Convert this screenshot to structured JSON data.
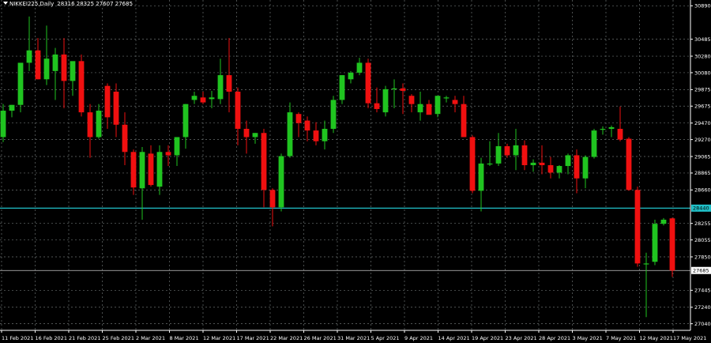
{
  "header": {
    "symbol": "NIKKEI225,Daily",
    "ohlc": "28316 28325 27607 27685"
  },
  "colors": {
    "bull": "#20c420",
    "bear": "#f01010",
    "grid": "#6a7070",
    "hline": "#20c0c8",
    "background": "#000000"
  },
  "chart_data": {
    "type": "candlestick",
    "symbol": "NIKKEI225",
    "timeframe": "Daily",
    "ylim": [
      26960,
      30960
    ],
    "y_ticks": [
      30890,
      30485,
      30280,
      30080,
      29875,
      29675,
      29470,
      29270,
      29065,
      28865,
      28660,
      28255,
      28055,
      27850,
      27445,
      27240,
      27040
    ],
    "x_labels": [
      "11 Feb 2021",
      "16 Feb 2021",
      "21 Feb 2021",
      "25 Feb 2021",
      "2 Mar 2021",
      "8 Mar 2021",
      "12 Mar 2021",
      "17 Mar 2021",
      "22 Mar 2021",
      "26 Mar 2021",
      "31 Mar 2021",
      "5 Apr 2021",
      "9 Apr 2021",
      "14 Apr 2021",
      "19 Apr 2021",
      "23 Apr 2021",
      "28 Apr 2021",
      "3 May 2021",
      "7 May 2021",
      "12 May 2021",
      "17 May 2021"
    ],
    "hlines": [
      {
        "value": 28440,
        "label": "28440"
      },
      {
        "value": 27685,
        "label": "27685"
      }
    ],
    "candles": [
      {
        "o": 29300,
        "h": 29700,
        "l": 29240,
        "c": 29620
      },
      {
        "o": 29620,
        "h": 29690,
        "l": 29540,
        "c": 29690
      },
      {
        "o": 29690,
        "h": 30050,
        "l": 29600,
        "c": 30200
      },
      {
        "o": 30200,
        "h": 30760,
        "l": 30100,
        "c": 30350
      },
      {
        "o": 30350,
        "h": 30500,
        "l": 30000,
        "c": 30000
      },
      {
        "o": 30000,
        "h": 30650,
        "l": 29930,
        "c": 30250
      },
      {
        "o": 30100,
        "h": 30380,
        "l": 29750,
        "c": 30300
      },
      {
        "o": 30300,
        "h": 30500,
        "l": 29650,
        "c": 29980
      },
      {
        "o": 29980,
        "h": 30150,
        "l": 29800,
        "c": 30220
      },
      {
        "o": 30220,
        "h": 30300,
        "l": 29550,
        "c": 29600
      },
      {
        "o": 29600,
        "h": 29700,
        "l": 29050,
        "c": 29300
      },
      {
        "o": 29300,
        "h": 29700,
        "l": 29280,
        "c": 29620
      },
      {
        "o": 29920,
        "h": 29950,
        "l": 29400,
        "c": 29540
      },
      {
        "o": 29850,
        "h": 29950,
        "l": 29300,
        "c": 29450
      },
      {
        "o": 29450,
        "h": 29600,
        "l": 28960,
        "c": 29120
      },
      {
        "o": 29120,
        "h": 29150,
        "l": 28600,
        "c": 28690
      },
      {
        "o": 28680,
        "h": 29180,
        "l": 28300,
        "c": 29120
      },
      {
        "o": 29100,
        "h": 29200,
        "l": 28700,
        "c": 28720
      },
      {
        "o": 28700,
        "h": 29200,
        "l": 28600,
        "c": 29120
      },
      {
        "o": 29120,
        "h": 29200,
        "l": 28950,
        "c": 29080
      },
      {
        "o": 29080,
        "h": 29300,
        "l": 28950,
        "c": 29300
      },
      {
        "o": 29300,
        "h": 29700,
        "l": 29160,
        "c": 29700
      },
      {
        "o": 29750,
        "h": 29850,
        "l": 29700,
        "c": 29800
      },
      {
        "o": 29780,
        "h": 29850,
        "l": 29700,
        "c": 29720
      },
      {
        "o": 29760,
        "h": 29860,
        "l": 29650,
        "c": 29780
      },
      {
        "o": 29760,
        "h": 30250,
        "l": 29700,
        "c": 30050
      },
      {
        "o": 30050,
        "h": 30500,
        "l": 29600,
        "c": 29850
      },
      {
        "o": 29850,
        "h": 29900,
        "l": 29200,
        "c": 29400
      },
      {
        "o": 29400,
        "h": 29500,
        "l": 29100,
        "c": 29300
      },
      {
        "o": 29300,
        "h": 29350,
        "l": 29220,
        "c": 29350
      },
      {
        "o": 29350,
        "h": 29400,
        "l": 28450,
        "c": 28660
      },
      {
        "o": 28660,
        "h": 28680,
        "l": 28220,
        "c": 28450
      },
      {
        "o": 28450,
        "h": 29100,
        "l": 28400,
        "c": 29070
      },
      {
        "o": 29070,
        "h": 29720,
        "l": 29050,
        "c": 29600
      },
      {
        "o": 29580,
        "h": 29600,
        "l": 29300,
        "c": 29470
      },
      {
        "o": 29500,
        "h": 29550,
        "l": 29250,
        "c": 29380
      },
      {
        "o": 29380,
        "h": 29480,
        "l": 29200,
        "c": 29250
      },
      {
        "o": 29250,
        "h": 29500,
        "l": 29150,
        "c": 29400
      },
      {
        "o": 29400,
        "h": 29800,
        "l": 29350,
        "c": 29750
      },
      {
        "o": 29750,
        "h": 30050,
        "l": 29700,
        "c": 30050
      },
      {
        "o": 30000,
        "h": 30100,
        "l": 29950,
        "c": 30080
      },
      {
        "o": 30080,
        "h": 30260,
        "l": 30050,
        "c": 30200
      },
      {
        "o": 30200,
        "h": 30250,
        "l": 29650,
        "c": 29710
      },
      {
        "o": 29710,
        "h": 29900,
        "l": 29600,
        "c": 29640
      },
      {
        "o": 29600,
        "h": 29920,
        "l": 29550,
        "c": 29880
      },
      {
        "o": 29880,
        "h": 30000,
        "l": 29650,
        "c": 29890
      },
      {
        "o": 29890,
        "h": 29950,
        "l": 29580,
        "c": 29860
      },
      {
        "o": 29800,
        "h": 29820,
        "l": 29600,
        "c": 29700
      },
      {
        "o": 29600,
        "h": 29850,
        "l": 29500,
        "c": 29700
      },
      {
        "o": 29700,
        "h": 29750,
        "l": 29580,
        "c": 29570
      },
      {
        "o": 29580,
        "h": 29800,
        "l": 29540,
        "c": 29800
      },
      {
        "o": 29780,
        "h": 29800,
        "l": 29720,
        "c": 29780
      },
      {
        "o": 29750,
        "h": 29800,
        "l": 29600,
        "c": 29700
      },
      {
        "o": 29700,
        "h": 29800,
        "l": 29300,
        "c": 29300
      },
      {
        "o": 29300,
        "h": 29320,
        "l": 28620,
        "c": 28650
      },
      {
        "o": 28650,
        "h": 29050,
        "l": 28400,
        "c": 28980
      },
      {
        "o": 28980,
        "h": 29250,
        "l": 28950,
        "c": 28980
      },
      {
        "o": 28980,
        "h": 29350,
        "l": 28950,
        "c": 29190
      },
      {
        "o": 29190,
        "h": 29220,
        "l": 29050,
        "c": 29080
      },
      {
        "o": 29080,
        "h": 29400,
        "l": 28900,
        "c": 29200
      },
      {
        "o": 29200,
        "h": 29260,
        "l": 28900,
        "c": 28960
      },
      {
        "o": 28960,
        "h": 29030,
        "l": 28880,
        "c": 28990
      },
      {
        "o": 28990,
        "h": 29200,
        "l": 28850,
        "c": 28960
      },
      {
        "o": 28960,
        "h": 29060,
        "l": 28800,
        "c": 28870
      },
      {
        "o": 28870,
        "h": 28960,
        "l": 28800,
        "c": 28950
      },
      {
        "o": 28950,
        "h": 29100,
        "l": 28850,
        "c": 29080
      },
      {
        "o": 29080,
        "h": 29150,
        "l": 28620,
        "c": 28800
      },
      {
        "o": 28800,
        "h": 29080,
        "l": 28680,
        "c": 29060
      },
      {
        "o": 29060,
        "h": 29400,
        "l": 29040,
        "c": 29380
      },
      {
        "o": 29400,
        "h": 29430,
        "l": 29330,
        "c": 29400
      },
      {
        "o": 29400,
        "h": 29440,
        "l": 29300,
        "c": 29420
      },
      {
        "o": 29400,
        "h": 29670,
        "l": 29250,
        "c": 29270
      },
      {
        "o": 29280,
        "h": 29300,
        "l": 28650,
        "c": 28660
      },
      {
        "o": 28660,
        "h": 28700,
        "l": 27730,
        "c": 27770
      },
      {
        "o": 27760,
        "h": 27900,
        "l": 27120,
        "c": 27770
      },
      {
        "o": 27790,
        "h": 28300,
        "l": 27750,
        "c": 28250
      },
      {
        "o": 28250,
        "h": 28320,
        "l": 28230,
        "c": 28300
      },
      {
        "o": 28316,
        "h": 28325,
        "l": 27607,
        "c": 27685
      }
    ]
  }
}
